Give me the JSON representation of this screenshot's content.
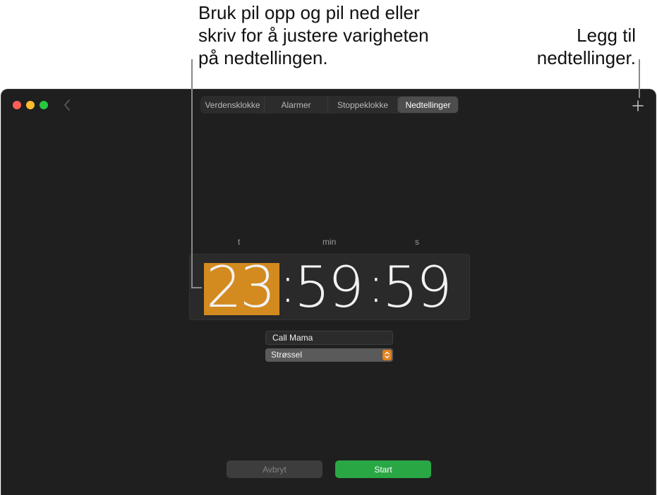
{
  "callouts": {
    "left_line1": "Bruk pil opp og pil ned eller",
    "left_line2": "skriv for å justere varigheten",
    "left_line3": "på nedtellingen.",
    "right_line1": "Legg til",
    "right_line2": "nedtellinger."
  },
  "tabs": [
    {
      "label": "Verdensklokke",
      "active": false
    },
    {
      "label": "Alarmer",
      "active": false
    },
    {
      "label": "Stoppeklokke",
      "active": false
    },
    {
      "label": "Nedtellinger",
      "active": true
    }
  ],
  "units": {
    "hours": "t",
    "minutes": "min",
    "seconds": "s"
  },
  "timer": {
    "hours": "23",
    "minutes": "59",
    "seconds": "59",
    "separator": ":"
  },
  "label_field": {
    "value": "Call Mama"
  },
  "sound_select": {
    "value": "Strøssel"
  },
  "buttons": {
    "cancel": "Avbryt",
    "start": "Start"
  },
  "colors": {
    "window_bg": "#1f1f1f",
    "highlight": "#d38a1f",
    "start_button": "#29a745",
    "stepper": "#e4811e"
  },
  "icons": {
    "back": "chevron-left-icon",
    "add": "plus-icon"
  }
}
